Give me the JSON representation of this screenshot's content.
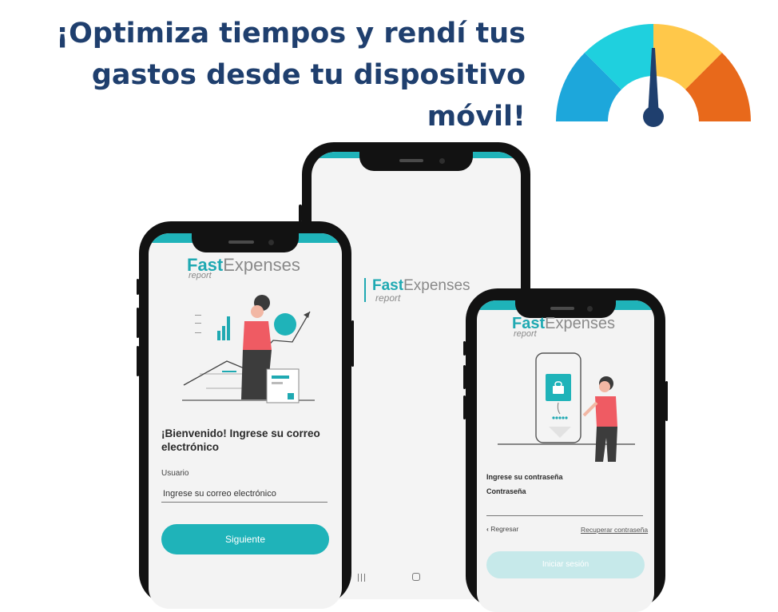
{
  "headline": {
    "line1": "¡Optimiza tiempos y rendí tus",
    "line2": "gastos desde tu dispositivo",
    "line3": "móvil!"
  },
  "gauge_icon": "speedometer-gauge-icon",
  "colors": {
    "teal": "#1fb3b9",
    "navy": "#1f3f6e",
    "button_disabled": "#c6e9ea",
    "gauge": [
      "#1da7db",
      "#1fd0de",
      "#ffc84a",
      "#e8691b"
    ]
  },
  "brand": {
    "fast": "Fast",
    "expenses": "Expenses",
    "report": "report"
  },
  "login_screen": {
    "welcome": "¡Bienvenido! Ingrese su correo",
    "welcome2": "electrónico",
    "field_label": "Usuario",
    "field_placeholder": "Ingrese su correo electrónico",
    "next_button": "Siguiente"
  },
  "splash_screen": {
    "nav_icons": [
      "recent-apps-icon",
      "home-icon"
    ]
  },
  "password_screen": {
    "heading": "Ingrese su contraseña",
    "field_label": "Contraseña",
    "back_link": "Regresar",
    "recover_link": "Recuperar contraseña",
    "login_button": "Iniciar sesión"
  }
}
